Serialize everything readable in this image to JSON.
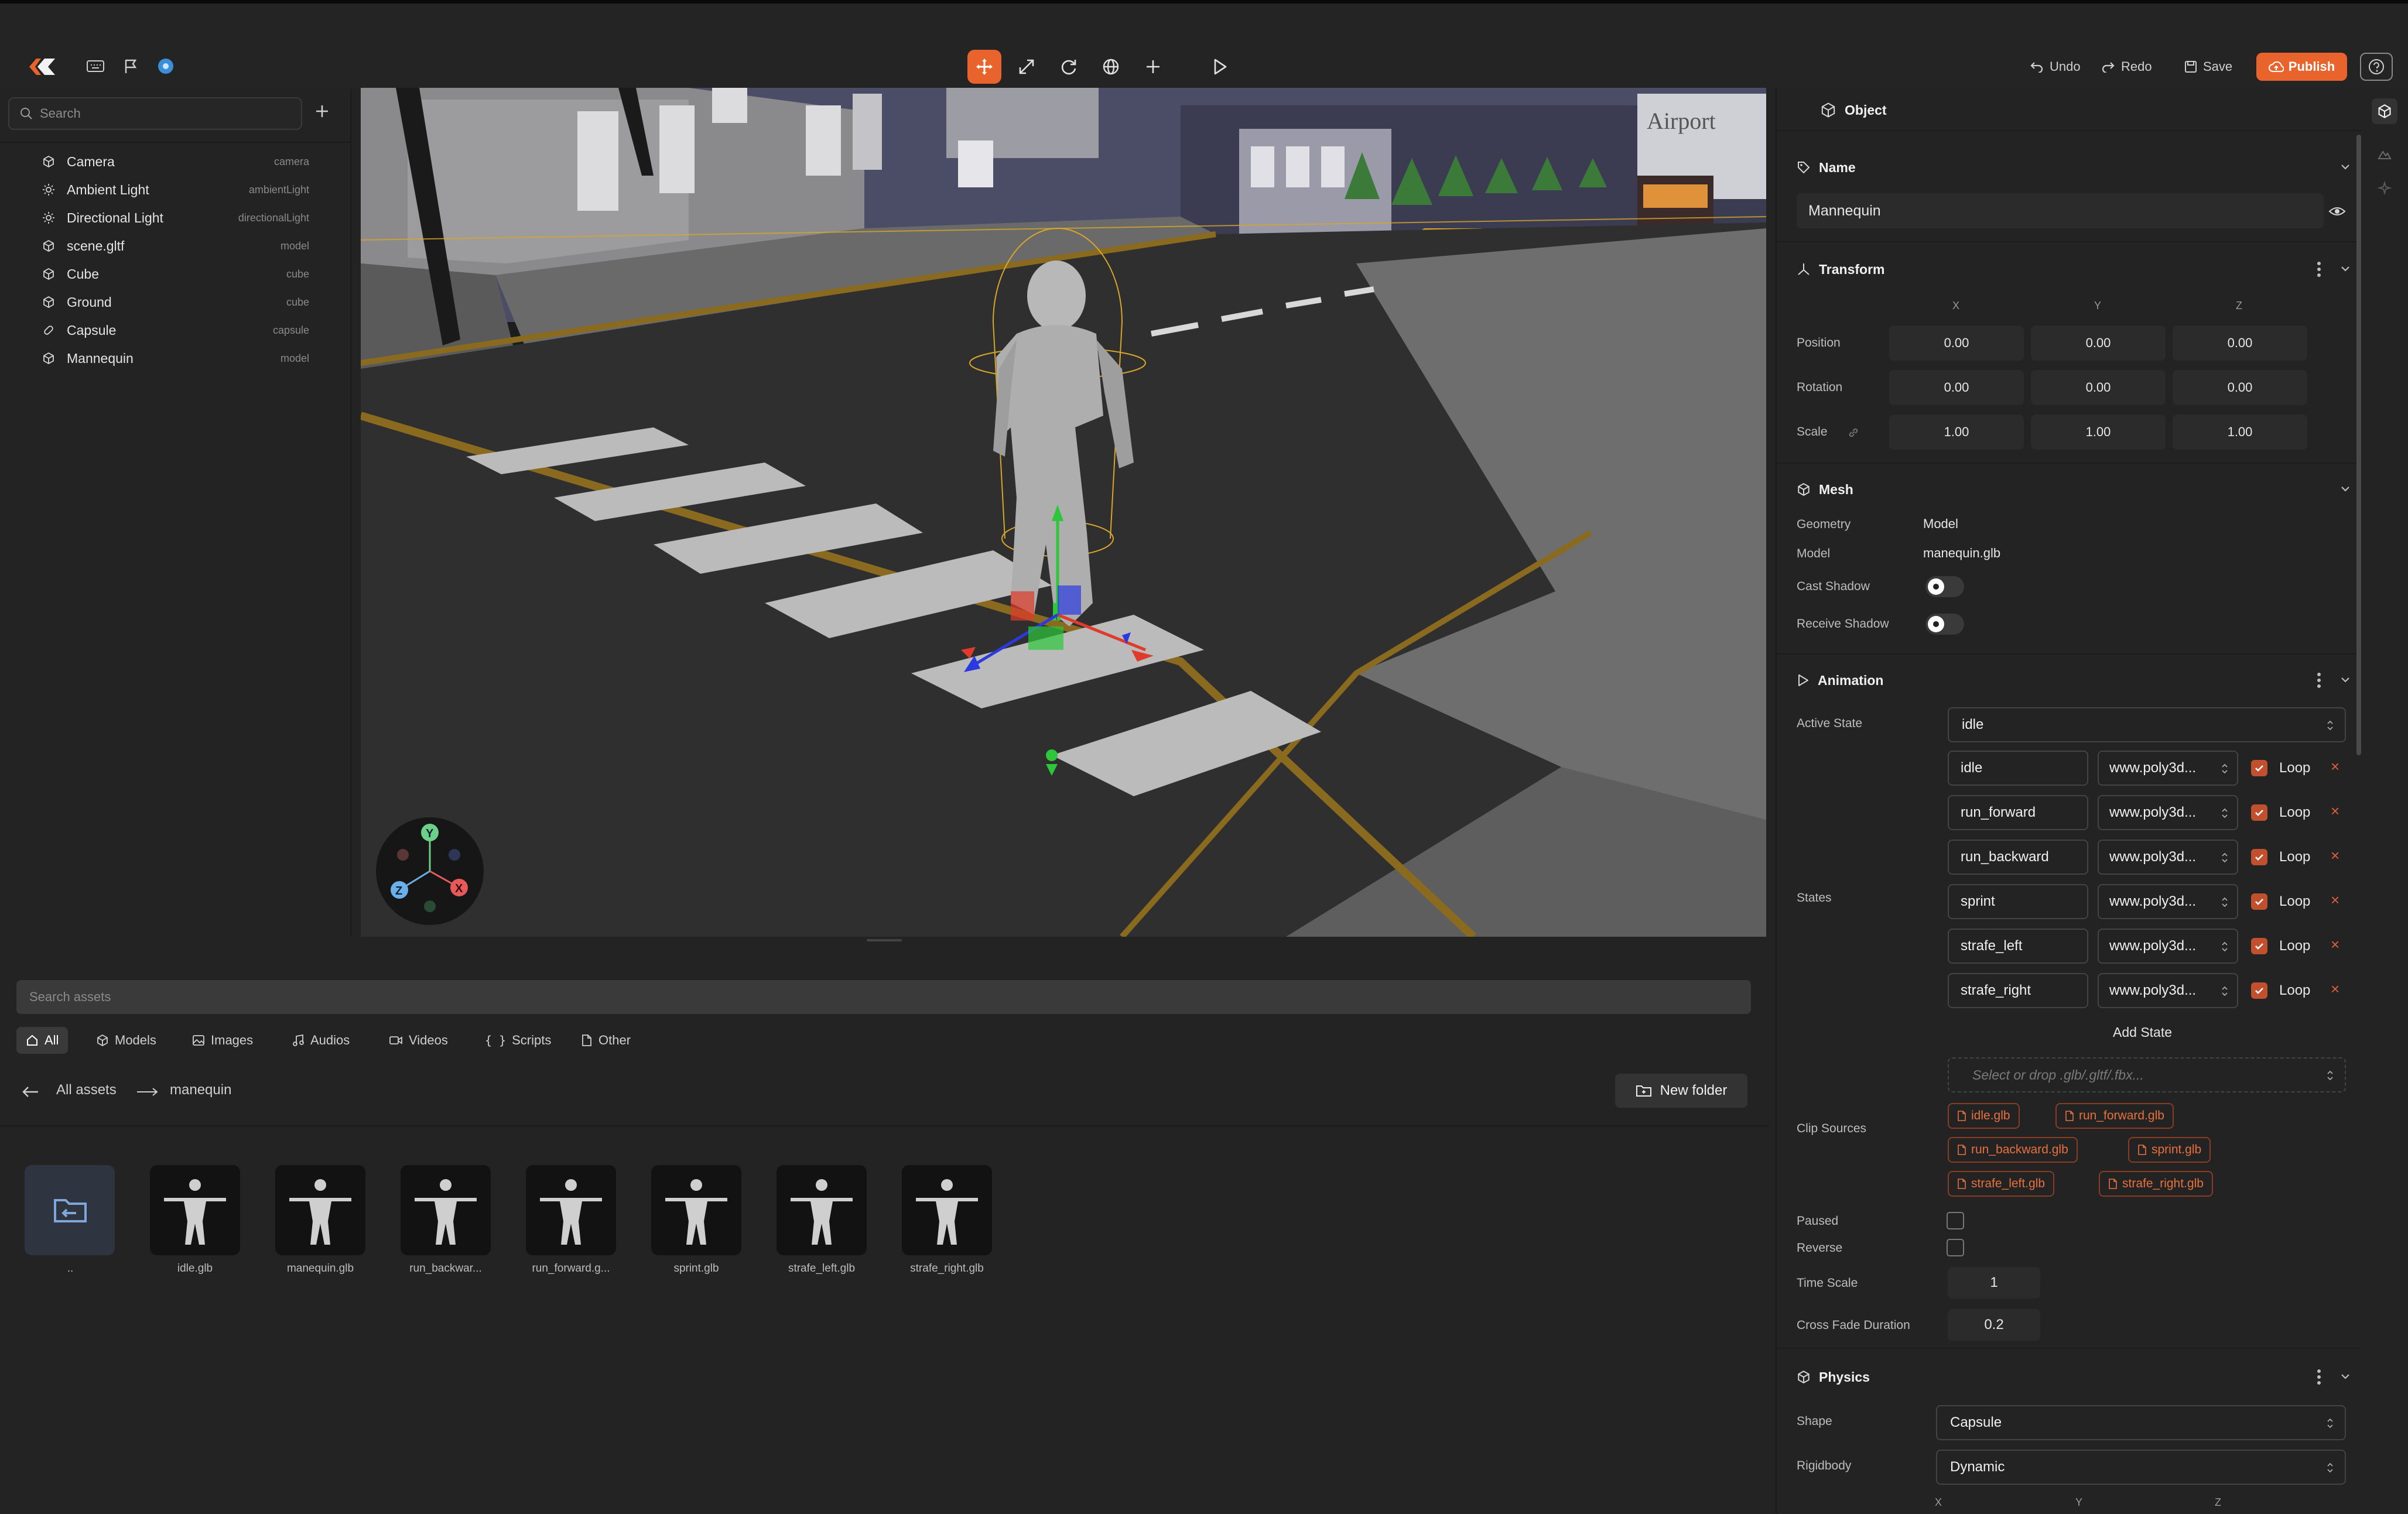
{
  "toolbar": {
    "undo": "Undo",
    "redo": "Redo",
    "save": "Save",
    "publish": "Publish"
  },
  "hierarchy": {
    "search_placeholder": "Search",
    "items": [
      {
        "name": "Camera",
        "type": "camera",
        "icon": "cube-icon"
      },
      {
        "name": "Ambient Light",
        "type": "ambientLight",
        "icon": "sun-icon"
      },
      {
        "name": "Directional Light",
        "type": "directionalLight",
        "icon": "sun-icon"
      },
      {
        "name": "scene.gltf",
        "type": "model",
        "icon": "cube-icon"
      },
      {
        "name": "Cube",
        "type": "cube",
        "icon": "cube-icon"
      },
      {
        "name": "Ground",
        "type": "cube",
        "icon": "cube-icon"
      },
      {
        "name": "Capsule",
        "type": "capsule",
        "icon": "capsule-icon"
      },
      {
        "name": "Mannequin",
        "type": "model",
        "icon": "cube-icon"
      }
    ]
  },
  "viewport": {
    "gizmo_axes": [
      "Y",
      "Z",
      "X"
    ],
    "sign_text": "Airport"
  },
  "assets": {
    "search_placeholder": "Search assets",
    "filters": [
      "All",
      "Models",
      "Images",
      "Audios",
      "Videos",
      "Scripts",
      "Other"
    ],
    "breadcrumb_root": "All assets",
    "breadcrumb_current": "manequin",
    "new_folder": "New folder",
    "folder_label": "..",
    "files": [
      "idle.glb",
      "manequin.glb",
      "run_backwar...",
      "run_forward.g...",
      "sprint.glb",
      "strafe_left.glb",
      "strafe_right.glb"
    ]
  },
  "inspector": {
    "title": "Object",
    "name_section": "Name",
    "name_value": "Mannequin",
    "transform_section": "Transform",
    "axes": [
      "X",
      "Y",
      "Z"
    ],
    "position_label": "Position",
    "rotation_label": "Rotation",
    "scale_label": "Scale",
    "position": [
      "0.00",
      "0.00",
      "0.00"
    ],
    "rotation": [
      "0.00",
      "0.00",
      "0.00"
    ],
    "scale": [
      "1.00",
      "1.00",
      "1.00"
    ],
    "mesh_section": "Mesh",
    "geometry_label": "Geometry",
    "geometry_value": "Model",
    "model_label": "Model",
    "model_value": "manequin.glb",
    "cast_shadow_label": "Cast Shadow",
    "receive_shadow_label": "Receive Shadow",
    "animation_section": "Animation",
    "active_state_label": "Active State",
    "active_state_value": "idle",
    "states_label": "States",
    "states": [
      {
        "name": "idle",
        "source": "www.poly3d...",
        "loop": "Loop"
      },
      {
        "name": "run_forward",
        "source": "www.poly3d...",
        "loop": "Loop"
      },
      {
        "name": "run_backward",
        "source": "www.poly3d...",
        "loop": "Loop"
      },
      {
        "name": "sprint",
        "source": "www.poly3d...",
        "loop": "Loop"
      },
      {
        "name": "strafe_left",
        "source": "www.poly3d...",
        "loop": "Loop"
      },
      {
        "name": "strafe_right",
        "source": "www.poly3d...",
        "loop": "Loop"
      }
    ],
    "add_state": "Add State",
    "clip_drop_placeholder": "Select or drop .glb/.gltf/.fbx...",
    "clip_sources_label": "Clip Sources",
    "clip_sources": [
      "idle.glb",
      "run_forward.glb",
      "run_backward.glb",
      "sprint.glb",
      "strafe_left.glb",
      "strafe_right.glb"
    ],
    "paused_label": "Paused",
    "reverse_label": "Reverse",
    "time_scale_label": "Time Scale",
    "time_scale_value": "1",
    "cross_fade_label": "Cross Fade Duration",
    "cross_fade_value": "0.2",
    "physics_section": "Physics",
    "shape_label": "Shape",
    "shape_value": "Capsule",
    "rigidbody_label": "Rigidbody",
    "rigidbody_value": "Dynamic"
  },
  "colors": {
    "accent": "#e8642c",
    "panel": "#232323",
    "clip_text": "#e8703e",
    "road_line": "#8a6a1e"
  }
}
